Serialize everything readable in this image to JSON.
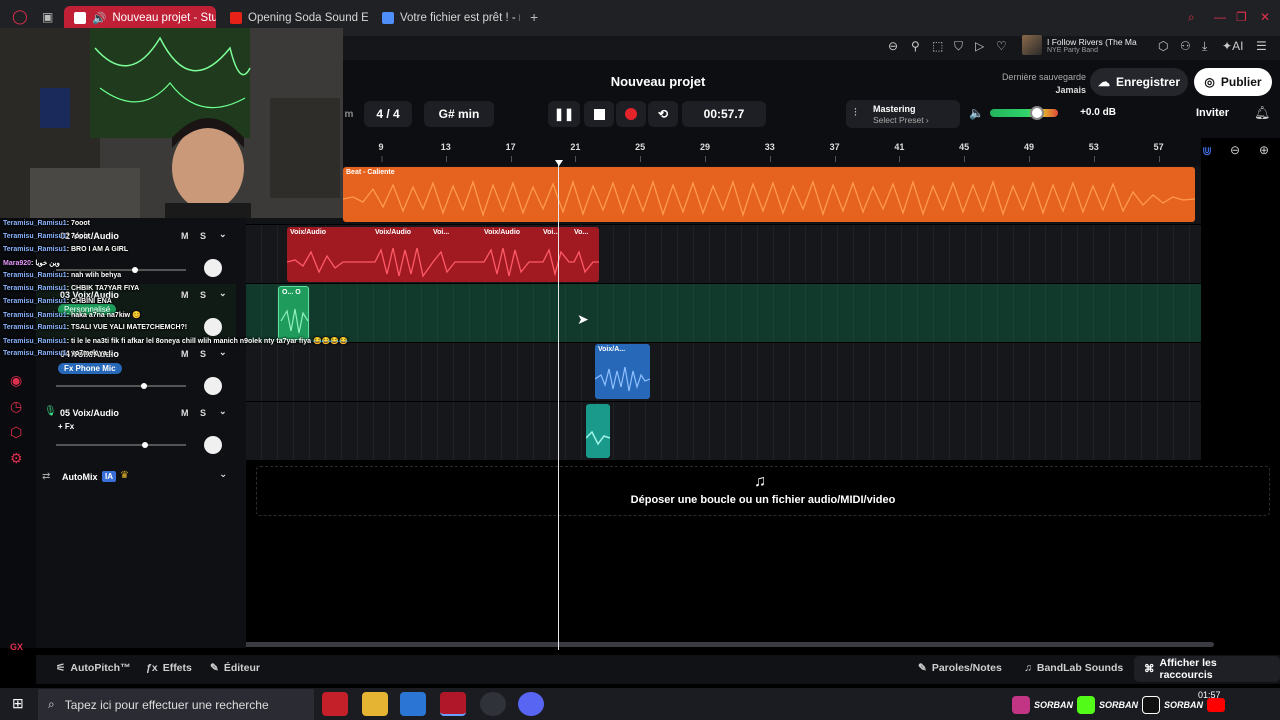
{
  "browser": {
    "tabs": [
      {
        "label": "Nouveau projet - Studio",
        "active": true
      },
      {
        "label": "Opening Soda Sound Effec",
        "active": false
      },
      {
        "label": "Votre fichier est prêt ! - no",
        "active": false
      }
    ],
    "new_tab": "+"
  },
  "media_widget": {
    "title": "I Follow Rivers (The Ma",
    "artist": "NYE Party Band"
  },
  "toolbar": {
    "ai_label": "AI"
  },
  "header": {
    "project_title": "Nouveau projet",
    "save_status_label": "Dernière sauvegarde",
    "save_status_value": "Jamais",
    "save_button": "Enregistrer",
    "publish_button": "Publier"
  },
  "transport": {
    "time_signature": "4 / 4",
    "key": "G# min",
    "time": "00:57.7",
    "tempo_fragment": "m",
    "mastering_label": "Mastering",
    "mastering_preset": "Select Preset ›",
    "volume_db": "+0.0 dB",
    "volume_level": 0.68,
    "invite": "Inviter"
  },
  "ruler": [
    "9",
    "13",
    "17",
    "21",
    "25",
    "29",
    "33",
    "37",
    "41",
    "45",
    "49",
    "53",
    "57"
  ],
  "tracks": [
    {
      "number": "02",
      "name": "Voix/Audio",
      "mute": "M",
      "solo": "S"
    },
    {
      "number": "03",
      "name": "Voix/Audio",
      "mute": "M",
      "solo": "S",
      "fx": "Personnalisé"
    },
    {
      "number": "04",
      "name": "Voix/Audio",
      "mute": "M",
      "solo": "S",
      "fx": "Fx Phone Mic"
    },
    {
      "number": "05",
      "name": "Voix/Audio",
      "mute": "M",
      "solo": "S",
      "fx": "+ Fx"
    }
  ],
  "clips": {
    "beat": "Beat - Caliente",
    "red": [
      "Voix/Audio",
      "Voix/Audio",
      "Voi...",
      "Voix/Audio",
      "Voi...",
      "Vo..."
    ],
    "green": "O... O",
    "blue": "Voix/A..."
  },
  "automix": {
    "label": "AutoMix",
    "badge": "IA"
  },
  "dropzone": "Déposer une boucle ou un fichier audio/MIDI/video",
  "bottom": {
    "autopitch": "AutoPitch™",
    "effects": "Effets",
    "editor": "Éditeur",
    "lyrics": "Paroles/Notes",
    "sounds": "BandLab Sounds",
    "shortcuts": "Afficher les raccourcis"
  },
  "chat": [
    {
      "user": "Teramisu_Ramisu1",
      "msg": ": 7ooot"
    },
    {
      "user": "Teramisu_Ramisu1",
      "msg": ": 7ooot"
    },
    {
      "user": "Teramisu_Ramisu1",
      "msg": ": BRO I AM A GIRL"
    },
    {
      "user": "Mara920",
      "msg": ": وين خويا"
    },
    {
      "user": "Teramisu_Ramisu1",
      "msg": ": nah wlih behya"
    },
    {
      "user": "Teramisu_Ramisu1",
      "msg": ": CHBIK TA7YAR FIYA"
    },
    {
      "user": "Teramisu_Ramisu1",
      "msg": ": CHBINI ENA"
    },
    {
      "user": "Teramisu_Ramisu1",
      "msg": ": haka a7na na7kiw 😊"
    },
    {
      "user": "Teramisu_Ramisu1",
      "msg": ": TSALI VUE YALI MATE7CHEMCH?!"
    },
    {
      "user": "Teramisu_Ramisu1",
      "msg": ": ti le le na3ti fik fi afkar lel 8oneya chill wlih manich n9olek nty ta7yar fiya 😂😂😂😂"
    },
    {
      "user": "Teramisu_Ramisu1",
      "msg": ": yo7mek ya..."
    }
  ],
  "taskbar": {
    "search_placeholder": "Tapez ici pour effectuer une recherche",
    "clock_time": "01:57",
    "clock_date": "..."
  },
  "overlay": {
    "tag": "SORBAN"
  },
  "corner": "GX"
}
